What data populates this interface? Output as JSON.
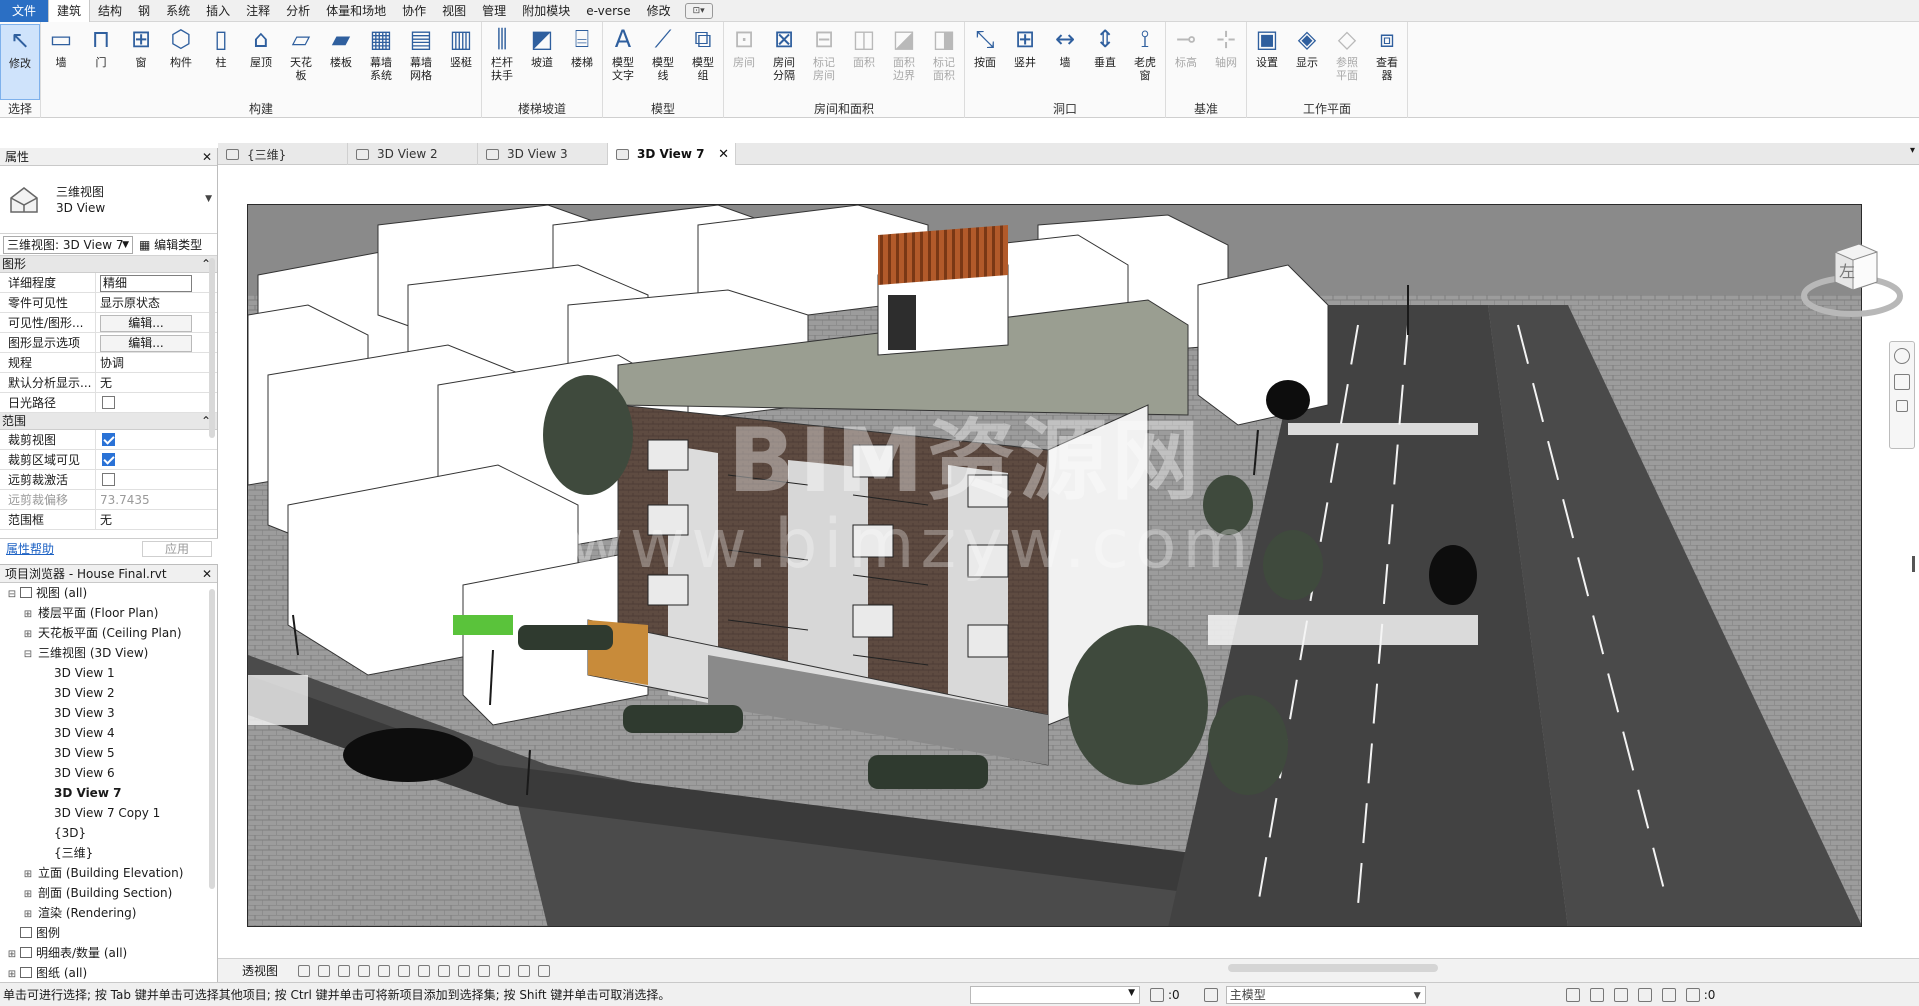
{
  "menu": {
    "tabs": [
      "文件",
      "建筑",
      "结构",
      "钢",
      "系统",
      "插入",
      "注释",
      "分析",
      "体量和场地",
      "协作",
      "视图",
      "管理",
      "附加模块",
      "e-verse",
      "修改"
    ],
    "active_tab": "建筑"
  },
  "ribbon": {
    "panels": [
      {
        "title": "选择",
        "tools": [
          {
            "label": "修改",
            "icon": "cursor-icon",
            "selected": true
          }
        ]
      },
      {
        "title": "构建",
        "tools": [
          {
            "label": "墙",
            "icon": "wall-icon"
          },
          {
            "label": "门",
            "icon": "door-icon"
          },
          {
            "label": "窗",
            "icon": "window-icon"
          },
          {
            "label": "构件",
            "icon": "component-icon"
          },
          {
            "label": "柱",
            "icon": "column-icon"
          },
          {
            "label": "屋顶",
            "icon": "roof-icon"
          },
          {
            "label": "天花板",
            "icon": "ceiling-icon"
          },
          {
            "label": "楼板",
            "icon": "floor-icon"
          },
          {
            "label": "幕墙系统",
            "icon": "curtain-system-icon"
          },
          {
            "label": "幕墙网格",
            "icon": "curtain-grid-icon"
          },
          {
            "label": "竖梃",
            "icon": "mullion-icon"
          }
        ]
      },
      {
        "title": "楼梯坡道",
        "tools": [
          {
            "label": "栏杆扶手",
            "icon": "railing-icon"
          },
          {
            "label": "坡道",
            "icon": "ramp-icon"
          },
          {
            "label": "楼梯",
            "icon": "stair-icon"
          }
        ]
      },
      {
        "title": "模型",
        "tools": [
          {
            "label": "模型文字",
            "icon": "model-text-icon"
          },
          {
            "label": "模型线",
            "icon": "model-line-icon"
          },
          {
            "label": "模型组",
            "icon": "model-group-icon"
          }
        ]
      },
      {
        "title": "房间和面积",
        "tools": [
          {
            "label": "房间",
            "icon": "room-icon",
            "disabled": true
          },
          {
            "label": "房间分隔",
            "icon": "room-separator-icon"
          },
          {
            "label": "标记房间",
            "icon": "tag-room-icon",
            "disabled": true
          },
          {
            "label": "面积",
            "icon": "area-icon",
            "disabled": true
          },
          {
            "label": "面积边界",
            "icon": "area-boundary-icon",
            "disabled": true
          },
          {
            "label": "标记面积",
            "icon": "tag-area-icon",
            "disabled": true
          }
        ]
      },
      {
        "title": "洞口",
        "tools": [
          {
            "label": "按面",
            "icon": "by-face-icon"
          },
          {
            "label": "竖井",
            "icon": "shaft-icon"
          },
          {
            "label": "墙",
            "icon": "wall-opening-icon"
          },
          {
            "label": "垂直",
            "icon": "vertical-icon"
          },
          {
            "label": "老虎窗",
            "icon": "dormer-icon"
          }
        ]
      },
      {
        "title": "基准",
        "tools": [
          {
            "label": "标高",
            "icon": "level-icon",
            "disabled": true
          },
          {
            "label": "轴网",
            "icon": "grid-icon",
            "disabled": true
          }
        ]
      },
      {
        "title": "工作平面",
        "tools": [
          {
            "label": "设置",
            "icon": "set-icon"
          },
          {
            "label": "显示",
            "icon": "show-icon"
          },
          {
            "label": "参照平面",
            "icon": "ref-plane-icon",
            "disabled": true
          },
          {
            "label": "查看器",
            "icon": "viewer-icon"
          }
        ]
      }
    ]
  },
  "properties": {
    "header": "属性",
    "type_name_1": "三维视图",
    "type_name_2": "3D View",
    "view_selector": "三维视图: 3D View 7",
    "edit_type": "编辑类型",
    "section_graphics": "图形",
    "section_extents": "范围",
    "rows_graphics": [
      {
        "k": "详细程度",
        "v": "精细",
        "kind": "box"
      },
      {
        "k": "零件可见性",
        "v": "显示原状态",
        "kind": "text"
      },
      {
        "k": "可见性/图形...",
        "v": "编辑...",
        "kind": "btn"
      },
      {
        "k": "图形显示选项",
        "v": "编辑...",
        "kind": "btn"
      },
      {
        "k": "规程",
        "v": "协调",
        "kind": "text"
      },
      {
        "k": "默认分析显示...",
        "v": "无",
        "kind": "text"
      },
      {
        "k": "日光路径",
        "v": "",
        "kind": "chk",
        "checked": false
      }
    ],
    "rows_extents": [
      {
        "k": "裁剪视图",
        "v": "",
        "kind": "chk",
        "checked": true
      },
      {
        "k": "裁剪区域可见",
        "v": "",
        "kind": "chk",
        "checked": true
      },
      {
        "k": "远剪裁激活",
        "v": "",
        "kind": "chk",
        "checked": false
      },
      {
        "k": "远剪裁偏移",
        "v": "73.7435",
        "kind": "text",
        "muted": true
      },
      {
        "k": "范围框",
        "v": "无",
        "kind": "text"
      }
    ],
    "help_link": "属性帮助",
    "apply": "应用"
  },
  "browser": {
    "header": "项目浏览器 - House Final.rvt",
    "items": [
      {
        "label": "视图 (all)",
        "indent": 0,
        "toggle": "⊟",
        "icon": "views-icon"
      },
      {
        "label": "楼层平面 (Floor Plan)",
        "indent": 1,
        "toggle": "⊞"
      },
      {
        "label": "天花板平面 (Ceiling Plan)",
        "indent": 1,
        "toggle": "⊞"
      },
      {
        "label": "三维视图 (3D View)",
        "indent": 1,
        "toggle": "⊟"
      },
      {
        "label": "3D View 1",
        "indent": 2
      },
      {
        "label": "3D View 2",
        "indent": 2
      },
      {
        "label": "3D View 3",
        "indent": 2
      },
      {
        "label": "3D View 4",
        "indent": 2
      },
      {
        "label": "3D View 5",
        "indent": 2
      },
      {
        "label": "3D View 6",
        "indent": 2
      },
      {
        "label": "3D View 7",
        "indent": 2,
        "bold": true
      },
      {
        "label": "3D View 7 Copy 1",
        "indent": 2
      },
      {
        "label": "{3D}",
        "indent": 2
      },
      {
        "label": "{三维}",
        "indent": 2
      },
      {
        "label": "立面 (Building Elevation)",
        "indent": 1,
        "toggle": "⊞"
      },
      {
        "label": "剖面 (Building Section)",
        "indent": 1,
        "toggle": "⊞"
      },
      {
        "label": "渲染 (Rendering)",
        "indent": 1,
        "toggle": "⊞"
      },
      {
        "label": "图例",
        "indent": 0,
        "icon": "legend-icon"
      },
      {
        "label": "明细表/数量 (all)",
        "indent": 0,
        "toggle": "⊞",
        "icon": "schedule-icon"
      },
      {
        "label": "图纸 (all)",
        "indent": 0,
        "toggle": "⊞",
        "icon": "sheets-icon"
      }
    ]
  },
  "view_tabs": [
    {
      "label": "{三维}",
      "active": false
    },
    {
      "label": "3D View 2",
      "active": false
    },
    {
      "label": "3D View 3",
      "active": false
    },
    {
      "label": "3D View 7",
      "active": true
    }
  ],
  "viewport": {
    "watermark_1": "BIM资源网",
    "watermark_2": "www.bimzyw.com",
    "viewcube_face": "左"
  },
  "view_control": {
    "label": "透视图"
  },
  "status": {
    "message": "单击可进行选择; 按 Tab 键并单击可选择其他项目; 按 Ctrl 键并单击可将新项目添加到选择集; 按 Shift 键并单击可取消选择。",
    "count_1": ":0",
    "model": "主模型",
    "count_2": ":0"
  }
}
